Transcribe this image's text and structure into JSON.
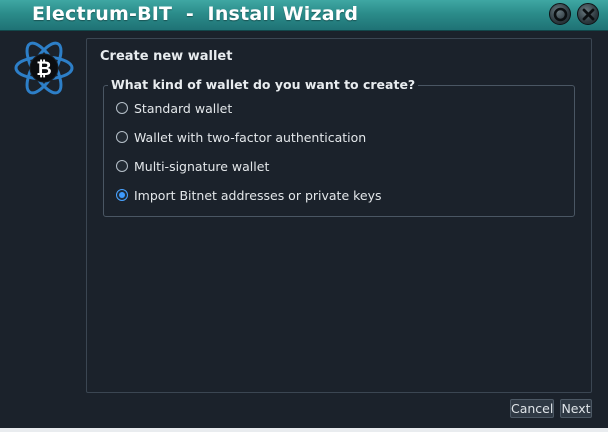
{
  "window": {
    "title": "Electrum-BIT  -  Install Wizard",
    "controls": {
      "maximize_icon": "circle-icon",
      "close_icon": "close-icon"
    }
  },
  "logo": {
    "icon": "bitcoin-atom-logo-icon",
    "symbol": "₿"
  },
  "page": {
    "title": "Create new wallet",
    "question": "What kind of wallet do you want to create?",
    "options": [
      {
        "label": "Standard wallet",
        "checked": false
      },
      {
        "label": "Wallet with two-factor authentication",
        "checked": false
      },
      {
        "label": "Multi-signature wallet",
        "checked": false
      },
      {
        "label": "Import Bitnet addresses or private keys",
        "checked": true
      }
    ]
  },
  "buttons": {
    "cancel_label": "Cancel",
    "next_label": "Next"
  },
  "colors": {
    "titlebar": "#2b8c8a",
    "background": "#1b222b",
    "accent": "#3d9bff",
    "logo_blue": "#2d7fc8"
  }
}
